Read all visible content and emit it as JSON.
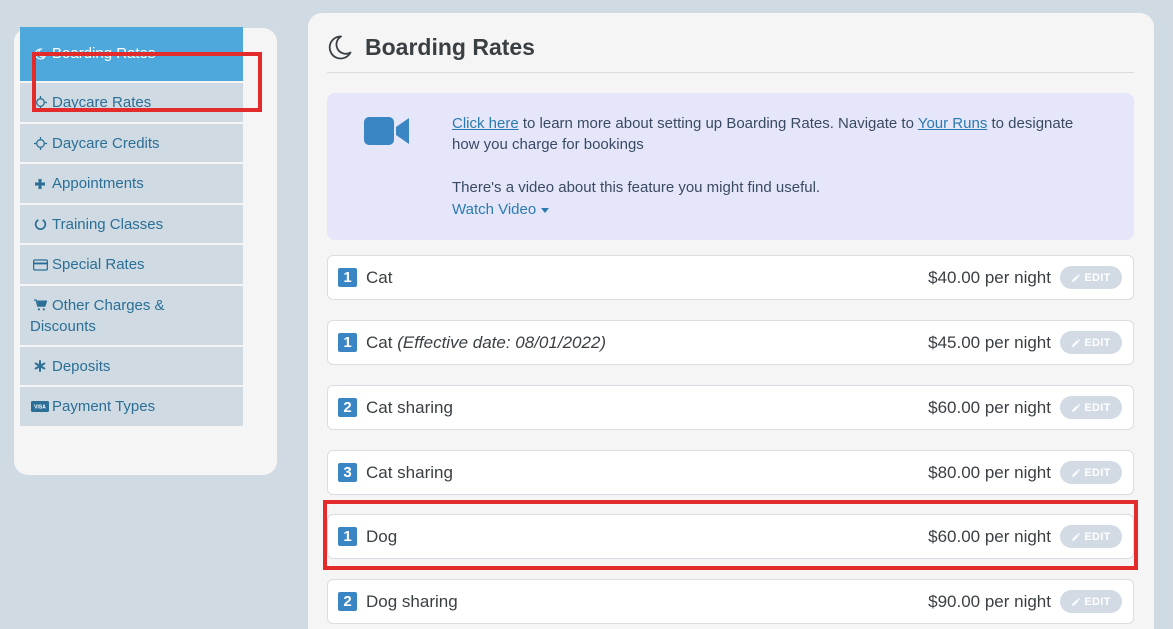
{
  "sidebar": {
    "items": [
      {
        "label": "Boarding Rates",
        "icon": "moon-icon"
      },
      {
        "label": "Daycare Rates",
        "icon": "sun-icon"
      },
      {
        "label": "Daycare Credits",
        "icon": "sun-icon"
      },
      {
        "label": "Appointments",
        "icon": "plus-icon"
      },
      {
        "label": "Training Classes",
        "icon": "circle-notch-icon"
      },
      {
        "label": "Special Rates",
        "icon": "credit-card-icon"
      },
      {
        "label": "Other Charges & Discounts",
        "icon": "cart-icon"
      },
      {
        "label": "Deposits",
        "icon": "asterisk-icon"
      },
      {
        "label": "Payment Types",
        "icon": "visa-card-icon"
      }
    ],
    "active_index": 0
  },
  "main": {
    "title": "Boarding Rates",
    "info": {
      "link1": "Click here",
      "text1": " to learn more about setting up Boarding Rates. Navigate to ",
      "link2": "Your Runs",
      "text2": " to designate how you charge for bookings",
      "video_text": "There's a video about this feature you might find useful.",
      "watch_label": "Watch Video"
    },
    "rates": [
      {
        "badge": "1",
        "name": "Cat",
        "note": "",
        "price": "$40.00 per night",
        "edit": "EDIT"
      },
      {
        "badge": "1",
        "name": "Cat ",
        "note": "(Effective date: 08/01/2022)",
        "price": "$45.00 per night",
        "edit": "EDIT"
      },
      {
        "badge": "2",
        "name": "Cat sharing",
        "note": "",
        "price": "$60.00 per night",
        "edit": "EDIT"
      },
      {
        "badge": "3",
        "name": "Cat sharing",
        "note": "",
        "price": "$80.00 per night",
        "edit": "EDIT"
      },
      {
        "badge": "1",
        "name": "Dog",
        "note": "",
        "price": "$60.00 per night",
        "edit": "EDIT"
      },
      {
        "badge": "2",
        "name": "Dog sharing",
        "note": "",
        "price": "$90.00 per night",
        "edit": "EDIT"
      }
    ]
  },
  "colors": {
    "accent": "#4ea8db",
    "badge": "#3a86c4",
    "highlight": "#e32b2b",
    "info_bg": "#e5e6fa"
  }
}
